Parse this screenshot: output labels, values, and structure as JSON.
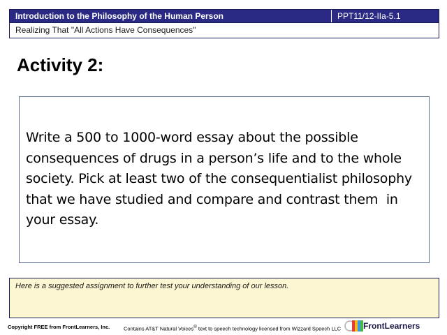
{
  "header": {
    "course_title": "Introduction to the Philosophy of the Human Person",
    "code": "PPT11/12-IIa-5.1",
    "subtitle": "Realizing That \"All Actions Have Consequences\""
  },
  "slide": {
    "title": "Activity 2:",
    "essay_text": "Write a 500 to 1000-word essay about the possible consequences of drugs in a person’s life and to the whole society. Pick at least two of the consequentialist philosophy that we have studied and compare and contrast them  in your essay."
  },
  "note": {
    "text": "Here is a suggested assignment to further test your understanding of our lesson."
  },
  "footer": {
    "copyright": "Copyright FREE from FrontLearners, Inc.",
    "voices_before": "Contains AT&T Natural Voices",
    "voices_reg": "®",
    "voices_after": " text to speech technology licensed from Wizzard Speech LLC",
    "brand": "FrontLearners"
  },
  "colors": {
    "header_bg": "#2a2a84",
    "note_bg": "#fdf6d2",
    "box_border": "#5a6b8e"
  }
}
